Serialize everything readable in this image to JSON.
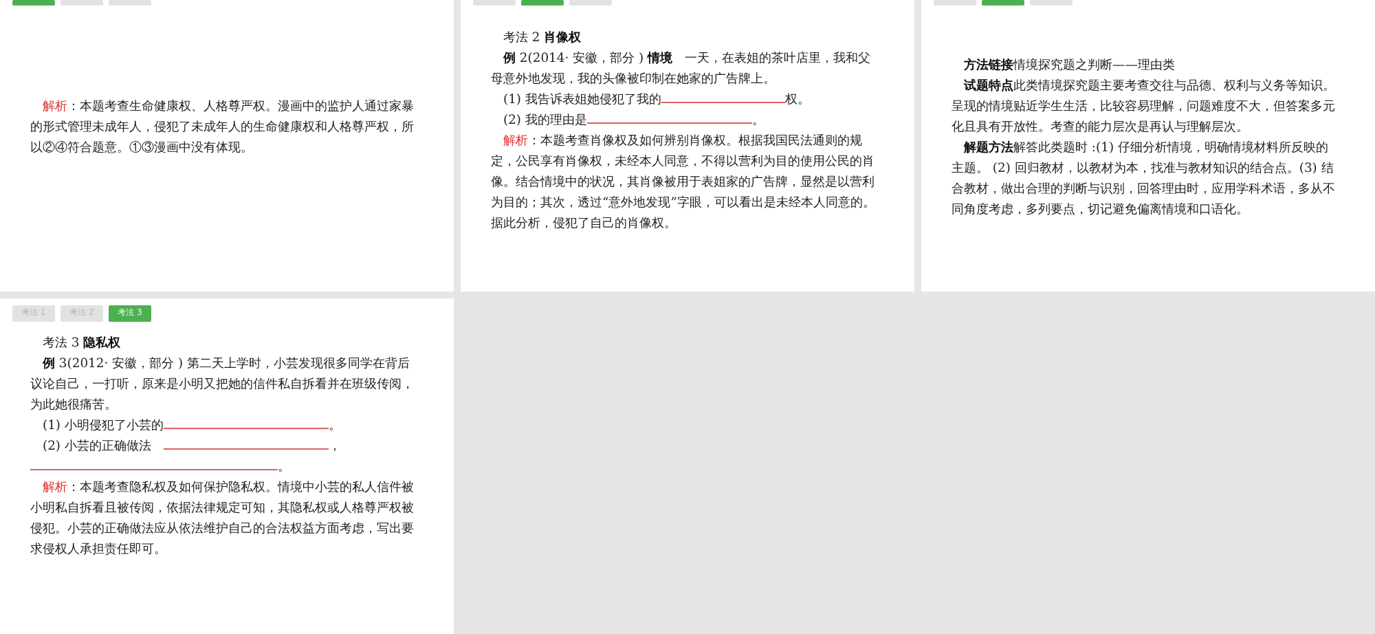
{
  "slides": [
    {
      "tabs": [
        {
          "selected": true
        },
        {
          "selected": false
        },
        {
          "selected": false
        }
      ],
      "blocks": [
        {
          "kind": "spacer"
        },
        {
          "kind": "para",
          "parts": [
            {
              "kind": "red",
              "text": "解析"
            },
            {
              "kind": "text",
              "text": "：本题考查生命健康权、人格尊严权。漫画中的监护人通过家暴的形式管理未成年人，侵犯了未成年人的生命健康权和人格尊严权，所以②④符合题意。①③漫画中没有体现。"
            }
          ]
        }
      ]
    },
    {
      "tabs": [
        {
          "selected": false
        },
        {
          "selected": true
        },
        {
          "selected": false
        }
      ],
      "blocks": [
        {
          "kind": "para",
          "parts": [
            {
              "kind": "text",
              "text": "考法 2 "
            },
            {
              "kind": "bold",
              "text": "肖像权"
            }
          ]
        },
        {
          "kind": "para",
          "parts": [
            {
              "kind": "bold",
              "text": "例"
            },
            {
              "kind": "text",
              "text": " 2(2014· 安徽，部分 ) "
            },
            {
              "kind": "bold",
              "text": "情境"
            },
            {
              "kind": "text",
              "text": "　一天，在表姐的茶叶店里，我和父母意外地发现，我的头像被印制在她家的广告牌上。"
            }
          ]
        },
        {
          "kind": "para",
          "parts": [
            {
              "kind": "text",
              "text": "(1) 我告诉表姐她侵犯了我的"
            },
            {
              "kind": "short_blank"
            },
            {
              "kind": "text",
              "text": "权。"
            }
          ]
        },
        {
          "kind": "para",
          "parts": [
            {
              "kind": "text",
              "text": "(2) 我的理由是"
            },
            {
              "kind": "long_blank"
            },
            {
              "kind": "text",
              "text": "。"
            }
          ]
        },
        {
          "kind": "para",
          "parts": [
            {
              "kind": "red",
              "text": "解析"
            },
            {
              "kind": "text",
              "text": "：本题考查肖像权及如何辨别肖像权。根据我国民法通则的规定，公民享有肖像权，未经本人同意，不得以营利为目的使用公民的肖像。结合情境中的状况，其肖像被用于表姐家的广告牌，显然是以营利为目的；其次，透过“意外地发现”字眼，可以看出是未经本人同意的。据此分析，侵犯了自己的肖像权。"
            }
          ]
        }
      ]
    },
    {
      "tabs": [
        {
          "selected": false
        },
        {
          "selected": true
        },
        {
          "selected": false
        }
      ],
      "blocks": [
        {
          "kind": "spacer"
        },
        {
          "kind": "para",
          "parts": [
            {
              "kind": "bold",
              "text": "方法链接"
            },
            {
              "kind": "text",
              "text": "情境探究题之判断——理由类"
            }
          ]
        },
        {
          "kind": "para",
          "parts": [
            {
              "kind": "bold",
              "text": "试题特点"
            },
            {
              "kind": "text",
              "text": "此类情境探究题主要考查交往与品德、权利与义务等知识。呈现的情境贴近学生生活，比较容易理解，问题难度不大，但答案多元化且具有开放性。考查的能力层次是再认与理解层次。"
            }
          ]
        },
        {
          "kind": "para",
          "parts": [
            {
              "kind": "bold",
              "text": "解题方法"
            },
            {
              "kind": "text",
              "text": "解答此类题时 :(1) 仔细分析情境，明确情境材料所反映的主题。 (2) 回归教材，以教材为本，找准与教材知识的结合点。(3) 结合教材，做出合理的判断与识别，回答理由时，应用学科术语，多从不同角度考虑，多列要点，切记避免偏离情境和口语化。"
            }
          ]
        }
      ]
    },
    {
      "tabs": [
        {
          "label": "考法 1",
          "selected": false
        },
        {
          "label": "考法 2",
          "selected": false
        },
        {
          "label": "考法 3",
          "selected": true
        }
      ],
      "blocks": [
        {
          "kind": "para",
          "parts": [
            {
              "kind": "text",
              "text": "考法 3 "
            },
            {
              "kind": "bold",
              "text": "隐私权"
            }
          ]
        },
        {
          "kind": "para",
          "parts": [
            {
              "kind": "bold",
              "text": "例"
            },
            {
              "kind": "text",
              "text": " 3(2012· 安徽，部分 ) 第二天上学时，小芸发现很多同学在背后议论自己，一打听，原来是小明又把她的信件私自拆看并在班级传阅，为此她很痛苦。"
            }
          ]
        },
        {
          "kind": "para",
          "parts": [
            {
              "kind": "text",
              "text": "(1) 小明侵犯了小芸的"
            },
            {
              "kind": "long_blank"
            },
            {
              "kind": "text",
              "text": "。"
            }
          ]
        },
        {
          "kind": "para",
          "parts": [
            {
              "kind": "text",
              "text": "(2) 小芸的正确做法　"
            },
            {
              "kind": "long_blank"
            },
            {
              "kind": "text",
              "text": "，"
            },
            {
              "kind": "wide_blank"
            },
            {
              "kind": "text",
              "text": "。"
            }
          ]
        },
        {
          "kind": "para",
          "parts": [
            {
              "kind": "red",
              "text": "解析"
            },
            {
              "kind": "text",
              "text": "：本题考查隐私权及如何保护隐私权。情境中小芸的私人信件被小明私自拆看且被传阅，依据法律规定可知，其隐私权或人格尊严权被侵犯。小芸的正确做法应从依法维护自己的合法权益方面考虑，写出要求侵权人承担责任即可。"
            }
          ]
        }
      ]
    }
  ]
}
